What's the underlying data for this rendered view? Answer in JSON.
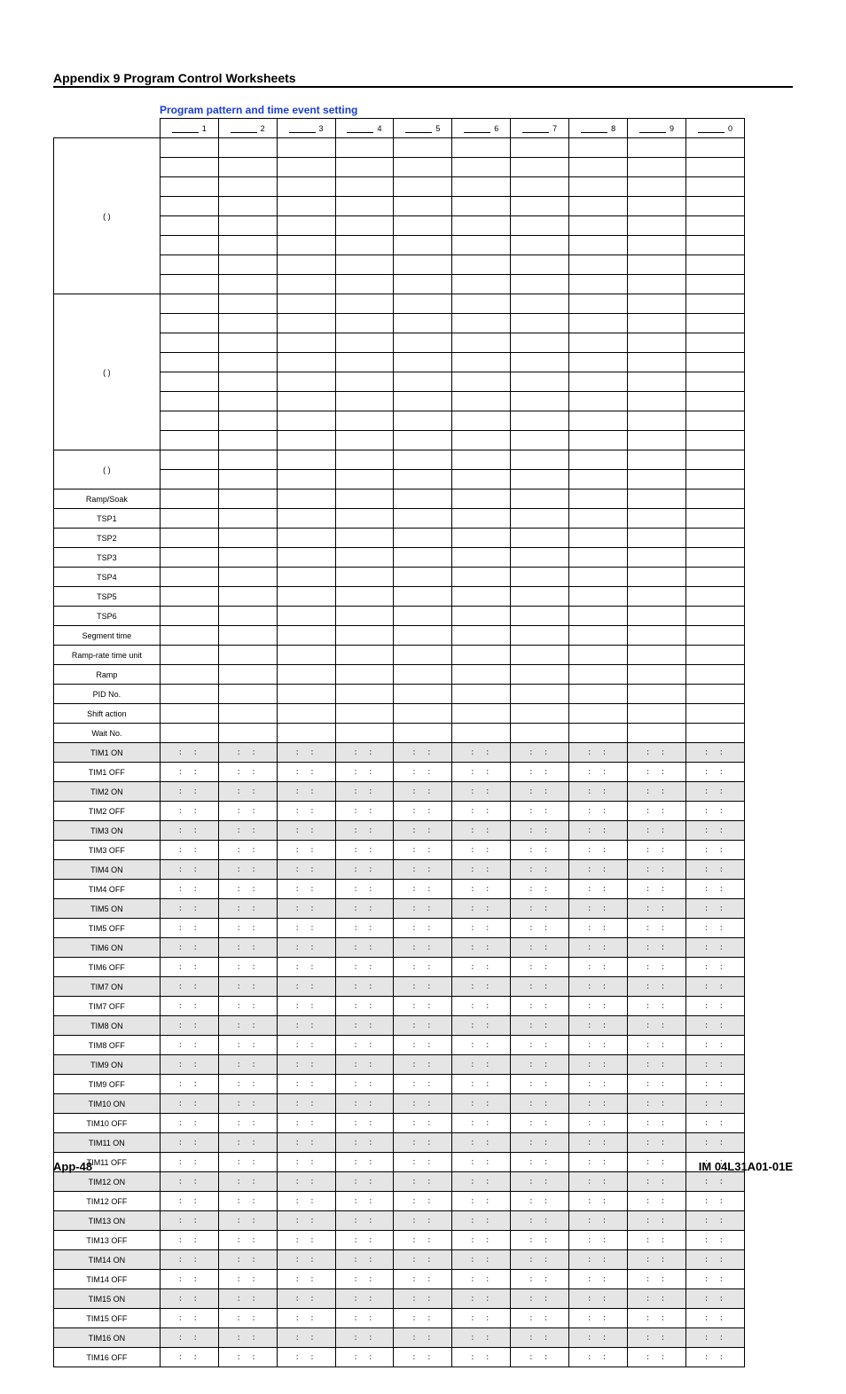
{
  "header": {
    "title": "Appendix 9 Program Control Worksheets"
  },
  "subheading": "Program pattern and time event setting",
  "colheads": [
    "1",
    "2",
    "3",
    "4",
    "5",
    "6",
    "7",
    "8",
    "9",
    "0"
  ],
  "topRows": [
    {
      "label": "(   )",
      "cls": "tallcell"
    },
    {
      "label": "(   )",
      "cls": "tallcell"
    },
    {
      "label": "(   )",
      "cls": "semitall"
    }
  ],
  "midRows": [
    "Ramp/Soak",
    "TSP1",
    "TSP2",
    "TSP3",
    "TSP4",
    "TSP5",
    "TSP6",
    "Segment time",
    "Ramp-rate time unit",
    "Ramp",
    "PID No.",
    "Shift action",
    "Wait No."
  ],
  "timRows": [
    "TIM1 ON",
    "TIM1 OFF",
    "TIM2 ON",
    "TIM2 OFF",
    "TIM3 ON",
    "TIM3 OFF",
    "TIM4 ON",
    "TIM4 OFF",
    "TIM5 ON",
    "TIM5 OFF",
    "TIM6 ON",
    "TIM6 OFF",
    "TIM7 ON",
    "TIM7 OFF",
    "TIM8 ON",
    "TIM8 OFF",
    "TIM9 ON",
    "TIM9 OFF",
    "TIM10 ON",
    "TIM10 OFF",
    "TIM11 ON",
    "TIM11 OFF",
    "TIM12 ON",
    "TIM12 OFF",
    "TIM13 ON",
    "TIM13 OFF",
    "TIM14 ON",
    "TIM14 OFF",
    "TIM15 ON",
    "TIM15 OFF",
    "TIM16 ON",
    "TIM16 OFF"
  ],
  "dots": ":   :",
  "footer": {
    "page": "App-48",
    "doc": "IM 04L31A01-01E"
  }
}
